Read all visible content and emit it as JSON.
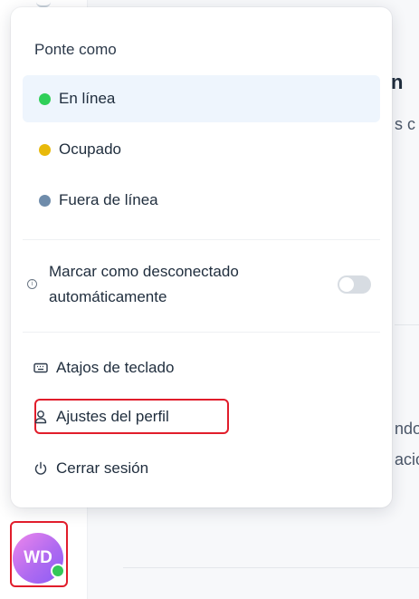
{
  "menu": {
    "heading": "Ponte como",
    "statuses": [
      {
        "label": "En línea",
        "color": "#2fcf58",
        "selected": true
      },
      {
        "label": "Ocupado",
        "color": "#e8b90a",
        "selected": false
      },
      {
        "label": "Fuera de línea",
        "color": "#6f8cab",
        "selected": false
      }
    ],
    "auto_offline_label": "Marcar como desconectado automáticamente",
    "auto_offline_enabled": false,
    "actions": {
      "shortcuts": "Atajos de teclado",
      "profile": "Ajustes del perfil",
      "logout": "Cerrar sesión"
    }
  },
  "avatar": {
    "initials": "WD",
    "status_color": "#34c759"
  },
  "background": {
    "title_fragment": "n",
    "subtitle_fragment": "s c",
    "line1_fragment": "ndo",
    "line2_fragment": "acio"
  }
}
